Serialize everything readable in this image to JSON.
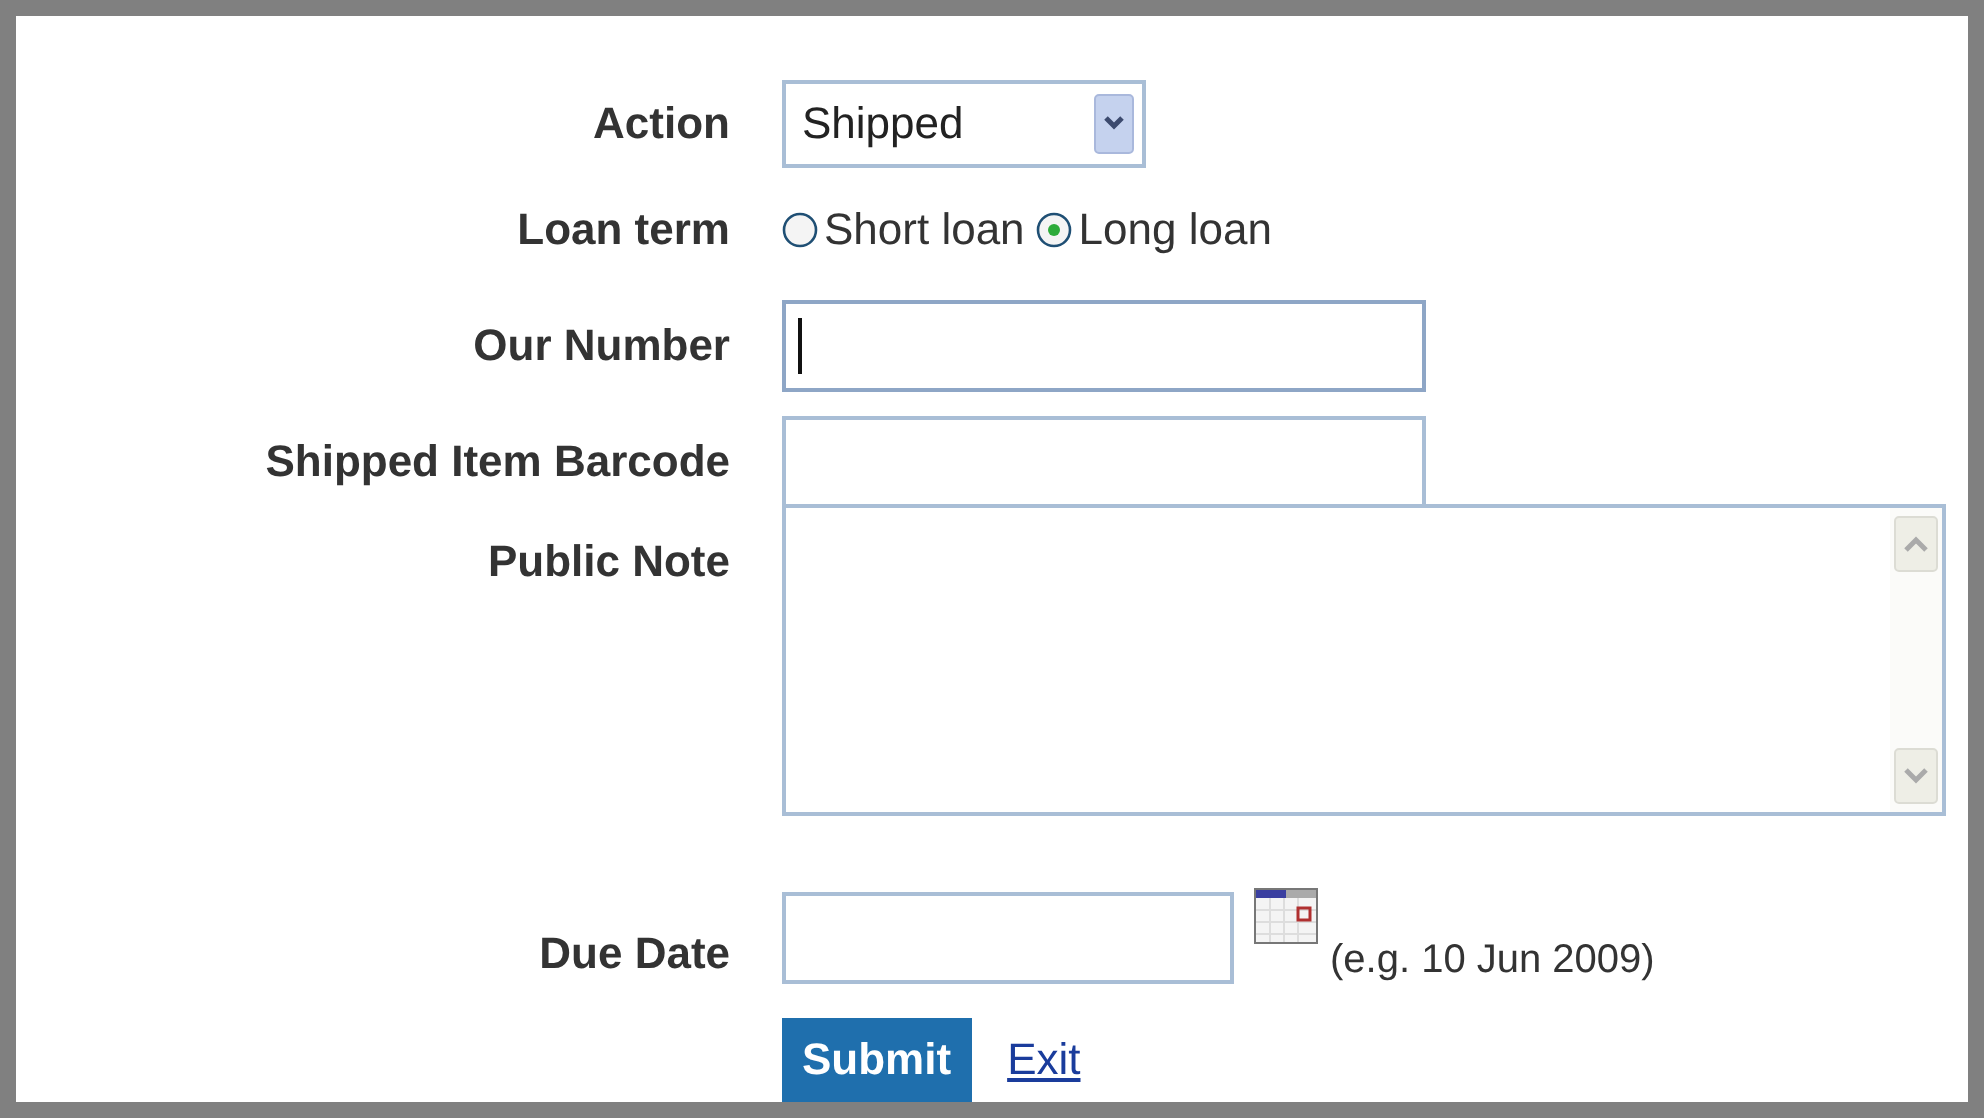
{
  "fields": [
    {
      "kind": "select",
      "label": "Action",
      "value": "Shipped"
    },
    {
      "kind": "radio",
      "label": "Loan term",
      "options": [
        {
          "label": "Short loan",
          "selected": false
        },
        {
          "label": "Long loan",
          "selected": true
        }
      ]
    },
    {
      "kind": "text",
      "label": "Our Number",
      "focused": true
    },
    {
      "kind": "text",
      "label": "Shipped Item Barcode",
      "focused": false
    },
    {
      "kind": "textarea",
      "label": "Public Note"
    },
    {
      "kind": "date",
      "label": "Due Date",
      "hint": "(e.g. 10 Jun 2009)"
    }
  ],
  "submit": "Submit",
  "exit": "Exit"
}
